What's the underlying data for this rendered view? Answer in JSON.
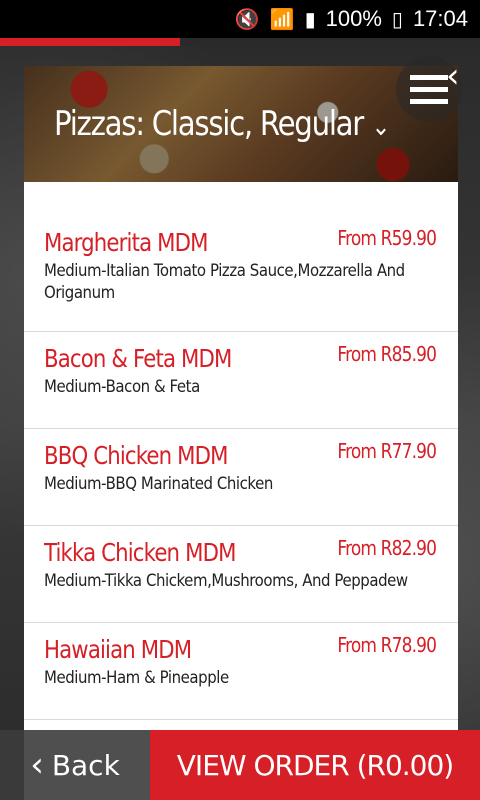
{
  "status": {
    "battery": "100%",
    "time": "17:04",
    "icons": [
      "mute-icon",
      "wifi-icon",
      "signal-icon",
      "battery-icon"
    ]
  },
  "progress": {
    "fraction": 0.375,
    "color": "#d61f26"
  },
  "header": {
    "title": "Pizzas: Classic, Regular",
    "chevron": "chevron-down-icon"
  },
  "items": [
    {
      "name": "Margherita MDM",
      "price": "From R59.90",
      "desc": "Medium-Italian Tomato Pizza Sauce,Mozzarella And Origanum"
    },
    {
      "name": "Bacon & Feta MDM",
      "price": "From R85.90",
      "desc": "Medium-Bacon & Feta"
    },
    {
      "name": "BBQ Chicken MDM",
      "price": "From R77.90",
      "desc": "Medium-BBQ Marinated Chicken"
    },
    {
      "name": "Tikka Chicken MDM",
      "price": "From R82.90",
      "desc": "Medium-Tikka Chickem,Mushrooms, And Peppadew"
    },
    {
      "name": "Hawaiian MDM",
      "price": "From R78.90",
      "desc": "Medium-Ham & Pineapple"
    }
  ],
  "footer": {
    "back_label": "Back",
    "view_order_label": "VIEW ORDER (R0.00)"
  },
  "colors": {
    "accent": "#d61f26"
  }
}
